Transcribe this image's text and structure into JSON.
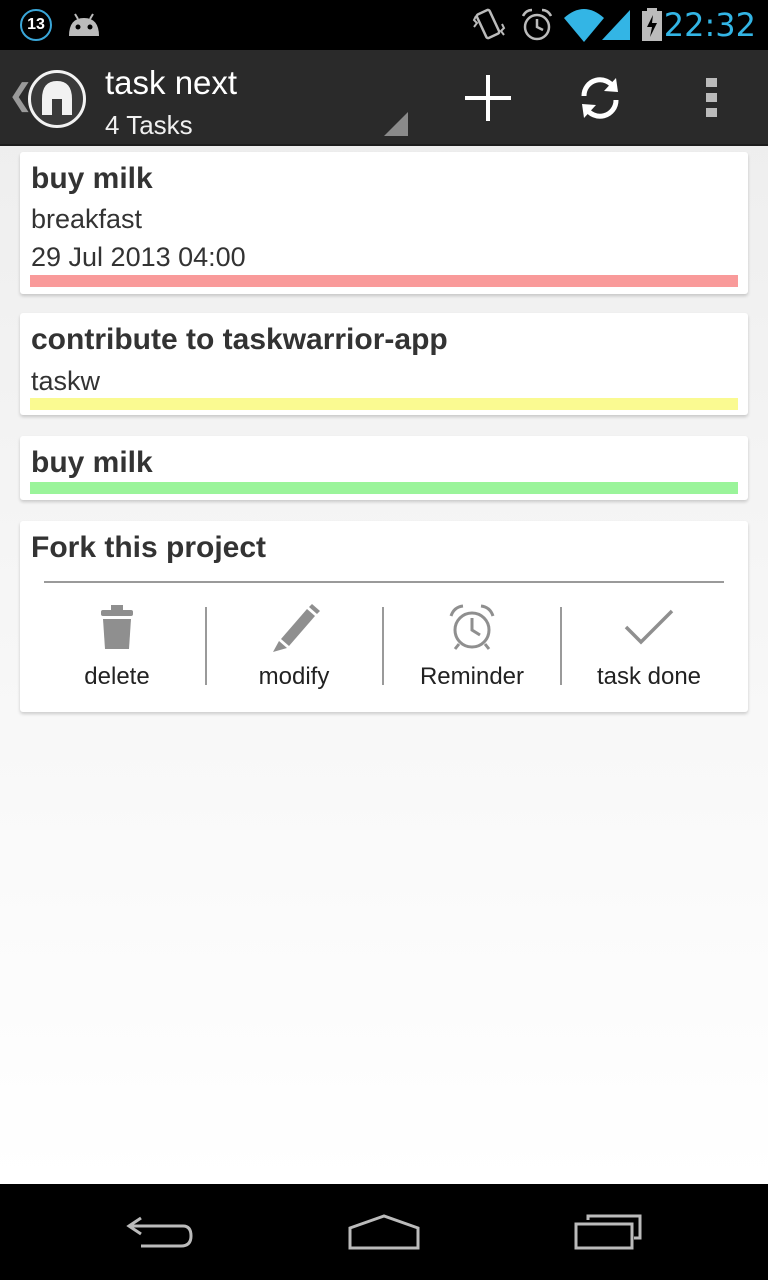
{
  "status_bar": {
    "notification_count": "13",
    "time": "22:32",
    "icons": [
      "android-icon",
      "vibrate-icon",
      "alarm-icon",
      "wifi-icon",
      "signal-icon",
      "battery-charging-icon"
    ]
  },
  "action_bar": {
    "title": "task next",
    "subtitle": "4 Tasks",
    "icons": [
      "app-logo-icon",
      "add-icon",
      "sync-icon",
      "overflow-menu-icon"
    ]
  },
  "tasks": [
    {
      "title": "buy milk",
      "project": "breakfast",
      "due": "29 Jul 2013 04:00",
      "priority_color": "#f99a9a"
    },
    {
      "title": "contribute to taskwarrior-app",
      "project": "taskw",
      "priority_color": "#fafa91"
    },
    {
      "title": "buy milk",
      "priority_color": "#9af49a"
    }
  ],
  "selected_task": {
    "title": "Fork this project",
    "actions": [
      {
        "label": "delete",
        "icon": "trash-icon"
      },
      {
        "label": "modify",
        "icon": "pencil-icon"
      },
      {
        "label": "Reminder",
        "icon": "alarm-clock-icon"
      },
      {
        "label": "task done",
        "icon": "checkmark-icon"
      }
    ]
  },
  "nav_bar": {
    "icons": [
      "back-icon",
      "home-icon",
      "recent-apps-icon"
    ]
  },
  "colors": {
    "accent": "#33b5e5",
    "action_bar": "#2a2a2a"
  }
}
